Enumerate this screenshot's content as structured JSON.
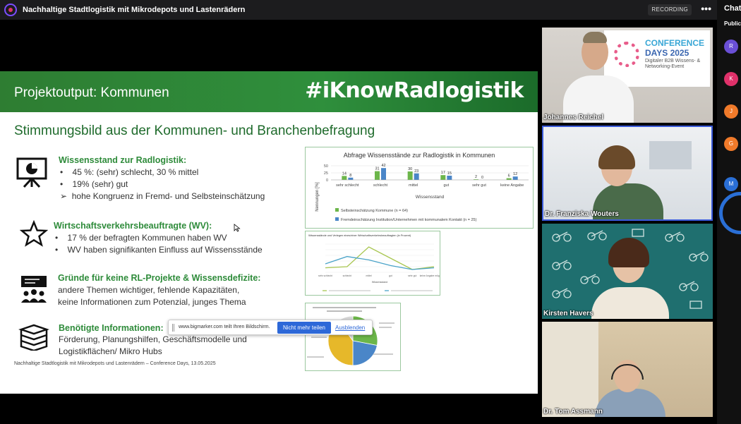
{
  "window": {
    "title": "Nachhaltige Stadtlogistik mit Mikrodepots und Lastenrädern",
    "recording_label": "RECORDING",
    "more_label": "•••"
  },
  "slide": {
    "title": "Projektoutput: Kommunen",
    "hashtag": "#iKnowRadlogistik",
    "heading": "Stimmungsbild aus der Kommunen- und Branchenbefragung",
    "sections": [
      {
        "icon": "presentation-chart-icon",
        "title": "Wissensstand zur Radlogistik:",
        "lines": [
          "45 %: (sehr) schlecht, 30 % mittel",
          "19% (sehr) gut",
          "hohe Kongruenz in Fremd- und Selbsteinschätzung"
        ]
      },
      {
        "icon": "star-icon",
        "title": "Wirtschaftsverkehrsbeauftragte (WV):",
        "lines": [
          "17 % der befragten Kommunen haben WV",
          "WV haben signifikanten Einfluss auf Wissensstände"
        ]
      },
      {
        "icon": "presenter-group-icon",
        "title": "Gründe für keine RL-Projekte & Wissensdefizite:",
        "lines": [
          "andere Themen wichtiger, fehlende Kapazitäten,",
          "keine Informationen zum Potenzial, junges Thema"
        ]
      },
      {
        "icon": "books-icon",
        "title": "Benötigte Informationen:",
        "lines": [
          "Förderung, Planungshilfen, Geschäftsmodelle und",
          "Logistikflächen/ Mikro Hubs"
        ]
      }
    ],
    "bullet_dot": "•",
    "bullet_arrow": "➢",
    "footer": "Nachhaltige Stadtlogistik mit Mikrodepots und Lastenrädern – Conference Days, 13.05.2025"
  },
  "chart_data": [
    {
      "type": "bar",
      "title": "Abfrage Wissensstände zur Radlogistik in Kommunen",
      "xlabel": "Wissensstand",
      "ylabel": "Nennungen [%]",
      "categories": [
        "sehr schlecht",
        "schlecht",
        "mittel",
        "gut",
        "sehr gut",
        "keine Angabe"
      ],
      "ylim": [
        0,
        50
      ],
      "yticks": [
        0,
        25,
        50
      ],
      "series": [
        {
          "name": "Selbsteinschätzung Kommune (n = 64)",
          "values": [
            14,
            31,
            30,
            17,
            2,
            6
          ],
          "color": "#6cb64a"
        },
        {
          "name": "Fremdeinschätzung Institution/Unternehmen mit kommunalem Kontakt (n = 25)",
          "values": [
            8,
            42,
            23,
            15,
            0,
            12
          ],
          "color": "#4a86c8"
        }
      ],
      "legend": "bottom"
    },
    {
      "type": "line",
      "title": "Wissensstände und Verlegen eines/einer Wirtschaftsverkehrsbeauftragten (in Prozent)",
      "xlabel": "Wissensstand",
      "categories": [
        "sehr schlecht",
        "schlecht",
        "mittel",
        "gut",
        "sehr gut",
        "keine Angabe möglich/nein"
      ],
      "series": [
        {
          "values": [
            8,
            10,
            45,
            25,
            5,
            10
          ],
          "color": "#a8c650"
        },
        {
          "values": [
            15,
            28,
            22,
            12,
            5,
            8
          ],
          "color": "#4aa3c8"
        }
      ],
      "legend": "bottom"
    },
    {
      "type": "pie",
      "values": [
        28,
        22,
        40,
        10
      ],
      "colors": [
        "#6cb64a",
        "#4a86c8",
        "#e6b82a",
        "#d8d8d8"
      ]
    }
  ],
  "share_bar": {
    "text": "www.bigmarker.com teilt Ihren Bildschirm.",
    "stop_label": "Nicht mehr teilen",
    "hide_label": "Ausblenden"
  },
  "videos": [
    {
      "name": "Johannes Reichel",
      "banner_line1": "CONFERENCE",
      "banner_line2": "DAYS 2025",
      "banner_sub": "Digitaler B2B Wissens- & Networking-Event"
    },
    {
      "name": "Dr. Franziska Wouters"
    },
    {
      "name": "Kirsten Havers"
    },
    {
      "name": "Dr. Tom Assmann"
    }
  ],
  "chat": {
    "title": "Chat",
    "tab": "Public",
    "avatars": [
      {
        "letter": "R",
        "color": "#6a4fd6"
      },
      {
        "letter": "K",
        "color": "#e0316a"
      },
      {
        "letter": "J",
        "color": "#f07a2a"
      },
      {
        "letter": "G",
        "color": "#f07a2a"
      },
      {
        "letter": "M",
        "color": "#2a6fd6"
      }
    ]
  }
}
